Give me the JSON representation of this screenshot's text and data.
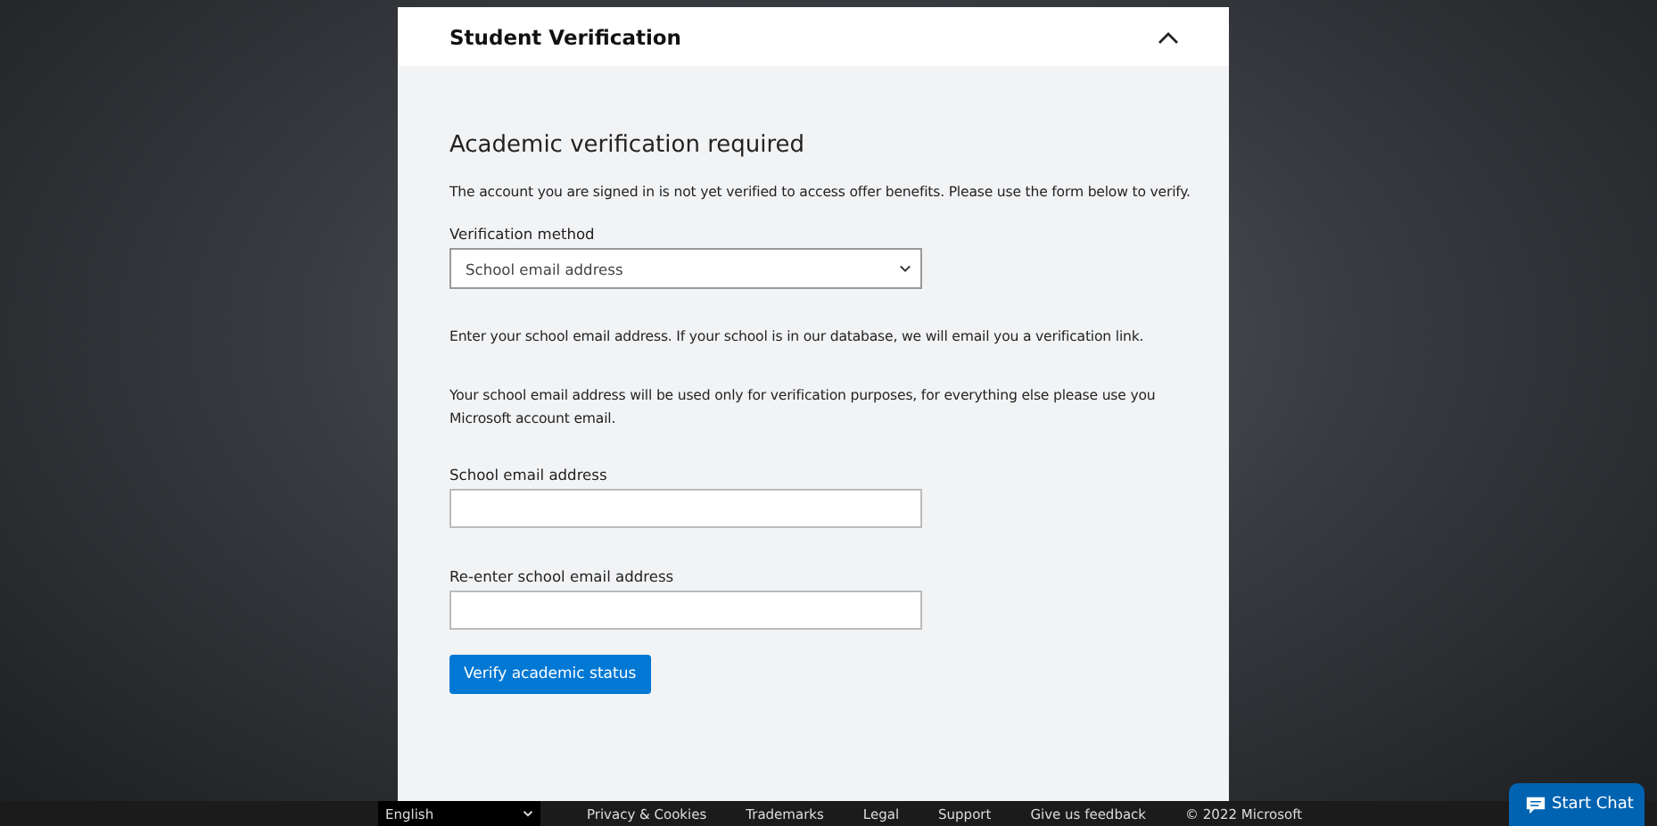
{
  "panel": {
    "title": "Student Verification",
    "expanded": true
  },
  "form": {
    "heading": "Academic verification required",
    "intro": "The account you are signed in is not yet verified to access offer benefits. Please use the form below to verify.",
    "method_label": "Verification method",
    "method_value": "School email address",
    "info": "Enter your school email address. If your school is in our database, we will email you a verification link.",
    "note": "Your school email address will be used only for verification purposes, for everything else please use you Microsoft account email.",
    "fields": [
      {
        "label": "School email address"
      },
      {
        "label": "Re-enter school email address"
      }
    ],
    "submit": "Verify academic status"
  },
  "footer": {
    "language": "English",
    "links": [
      "Privacy & Cookies",
      "Trademarks",
      "Legal",
      "Support",
      "Give us feedback"
    ],
    "copyright": "© 2022 Microsoft"
  },
  "chat": {
    "label": "Start Chat"
  }
}
